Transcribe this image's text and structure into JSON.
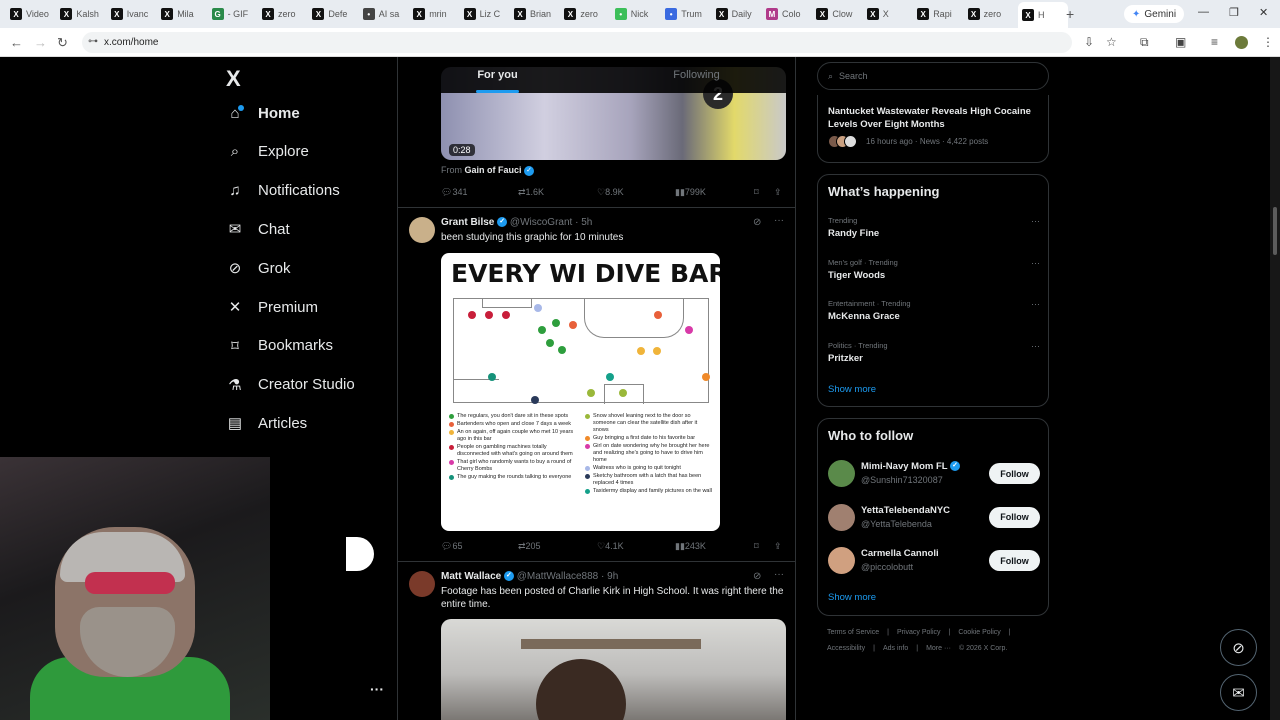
{
  "browser": {
    "tabs": [
      {
        "label": "Video",
        "icon": "x-icon"
      },
      {
        "label": "Kalsh",
        "icon": "x-icon"
      },
      {
        "label": "Ivanc",
        "icon": "x-icon"
      },
      {
        "label": "Mila",
        "icon": "x-icon"
      },
      {
        "label": "- GIF",
        "icon": "gif-icon"
      },
      {
        "label": "zero",
        "icon": "x-icon"
      },
      {
        "label": "Defe",
        "icon": "x-icon"
      },
      {
        "label": "AI sa",
        "icon": "ai-icon"
      },
      {
        "label": "mrin",
        "icon": "x-icon"
      },
      {
        "label": "Liz C",
        "icon": "x-icon"
      },
      {
        "label": "Brian",
        "icon": "x-icon"
      },
      {
        "label": "zero",
        "icon": "x-icon"
      },
      {
        "label": "Nick",
        "icon": "green-icon"
      },
      {
        "label": "Trum",
        "icon": "butterfly-icon"
      },
      {
        "label": "Daily",
        "icon": "x-icon"
      },
      {
        "label": "Colo",
        "icon": "mail-icon"
      },
      {
        "label": "Clow",
        "icon": "x-icon"
      },
      {
        "label": "X",
        "icon": "x-icon"
      },
      {
        "label": "Rapi",
        "icon": "x-icon"
      },
      {
        "label": "zero",
        "icon": "x-icon"
      },
      {
        "label": "H",
        "icon": "x-icon"
      }
    ],
    "gemini_label": "Gemini",
    "url": "x.com/home"
  },
  "nav": {
    "logo": "X",
    "items": [
      {
        "label": "Home",
        "icon": "home-icon"
      },
      {
        "label": "Explore",
        "icon": "search-icon"
      },
      {
        "label": "Notifications",
        "icon": "bell-icon"
      },
      {
        "label": "Chat",
        "icon": "mail-icon"
      },
      {
        "label": "Grok",
        "icon": "grok-icon"
      },
      {
        "label": "Premium",
        "icon": "x-icon"
      },
      {
        "label": "Bookmarks",
        "icon": "bookmark-icon"
      },
      {
        "label": "Creator Studio",
        "icon": "flask-icon"
      },
      {
        "label": "Articles",
        "icon": "article-icon"
      }
    ]
  },
  "feed": {
    "tabs": [
      "For you",
      "Following"
    ],
    "tweet1": {
      "duration": "0:28",
      "from_label": "From",
      "from_name": "Gain of Fauci",
      "stats": {
        "replies": "341",
        "reposts": "1.6K",
        "likes": "8.9K",
        "views": "799K"
      }
    },
    "tweet2": {
      "name": "Grant Bilse",
      "handle": "@WiscoGrant",
      "time": "· 5h",
      "text": "been studying this graphic for 10 minutes",
      "graphic_title": "EVERY WI DIVE BAR",
      "legend_left": [
        {
          "text": "The regulars, you don't dare sit in these spots",
          "color": "#2e9e3d"
        },
        {
          "text": "Bartenders who open and close 7 days a week",
          "color": "#e8603a"
        },
        {
          "text": "An on again, off again couple who met 10 years ago in this bar",
          "color": "#f0b43a"
        },
        {
          "text": "People on gambling machines totally disconnected with what's going on around them",
          "color": "#c81e3a"
        },
        {
          "text": "That girl who randomly wants to buy a round of Cherry Bombs",
          "color": "#d83aa8"
        },
        {
          "text": "The guy making the rounds talking to everyone",
          "color": "#16927a"
        }
      ],
      "legend_right": [
        {
          "text": "Snow shovel leaning next to the door so someone can clear the satellite dish after it snows",
          "color": "#9ab83a"
        },
        {
          "text": "Guy bringing a first date to his favorite bar",
          "color": "#f08a2a"
        },
        {
          "text": "Girl on date wondering why he brought her here and realizing she's going to have to drive him home",
          "color": "#d83aa8"
        },
        {
          "text": "Waitress who is going to quit tonight",
          "color": "#a8b8e8"
        },
        {
          "text": "Sketchy bathroom with a latch that has been replaced 4 times",
          "color": "#2a3a5a"
        },
        {
          "text": "Taxidermy display and family pictures on the wall",
          "color": "#14a08a"
        }
      ],
      "stats": {
        "replies": "65",
        "reposts": "205",
        "likes": "4.1K",
        "views": "243K"
      }
    },
    "tweet3": {
      "name": "Matt Wallace",
      "handle": "@MattWallace888",
      "time": "· 9h",
      "text": "Footage has been posted of Charlie Kirk in High School. It was right there the entire time."
    }
  },
  "sidebar": {
    "search_placeholder": "Search",
    "news": {
      "title": "Nantucket Wastewater Reveals High Cocaine Levels Over Eight Months",
      "meta": "16 hours ago · News · 4,422 posts"
    },
    "whats_happening": {
      "heading": "What’s happening",
      "trends": [
        {
          "meta": "Trending",
          "title": "Randy Fine"
        },
        {
          "meta": "Men's golf · Trending",
          "title": "Tiger Woods"
        },
        {
          "meta": "Entertainment · Trending",
          "title": "McKenna Grace"
        },
        {
          "meta": "Politics · Trending",
          "title": "Pritzker"
        }
      ],
      "show_more": "Show more"
    },
    "who_to_follow": {
      "heading": "Who to follow",
      "accounts": [
        {
          "name": "Mimi-Navy Mom FL",
          "handle": "@Sunshin71320087",
          "button": "Follow"
        },
        {
          "name": "YettaTelebendaNYC",
          "handle": "@YettaTelebenda",
          "button": "Follow"
        },
        {
          "name": "Carmella Cannoli",
          "handle": "@piccolobutt",
          "button": "Follow"
        }
      ],
      "show_more": "Show more"
    },
    "footer": {
      "line1": [
        "Terms of Service",
        "|",
        "Privacy Policy",
        "|",
        "Cookie Policy",
        "|"
      ],
      "line2": [
        "Accessibility",
        "|",
        "Ads info",
        "|",
        "More ···",
        "© 2026 X Corp."
      ]
    }
  }
}
